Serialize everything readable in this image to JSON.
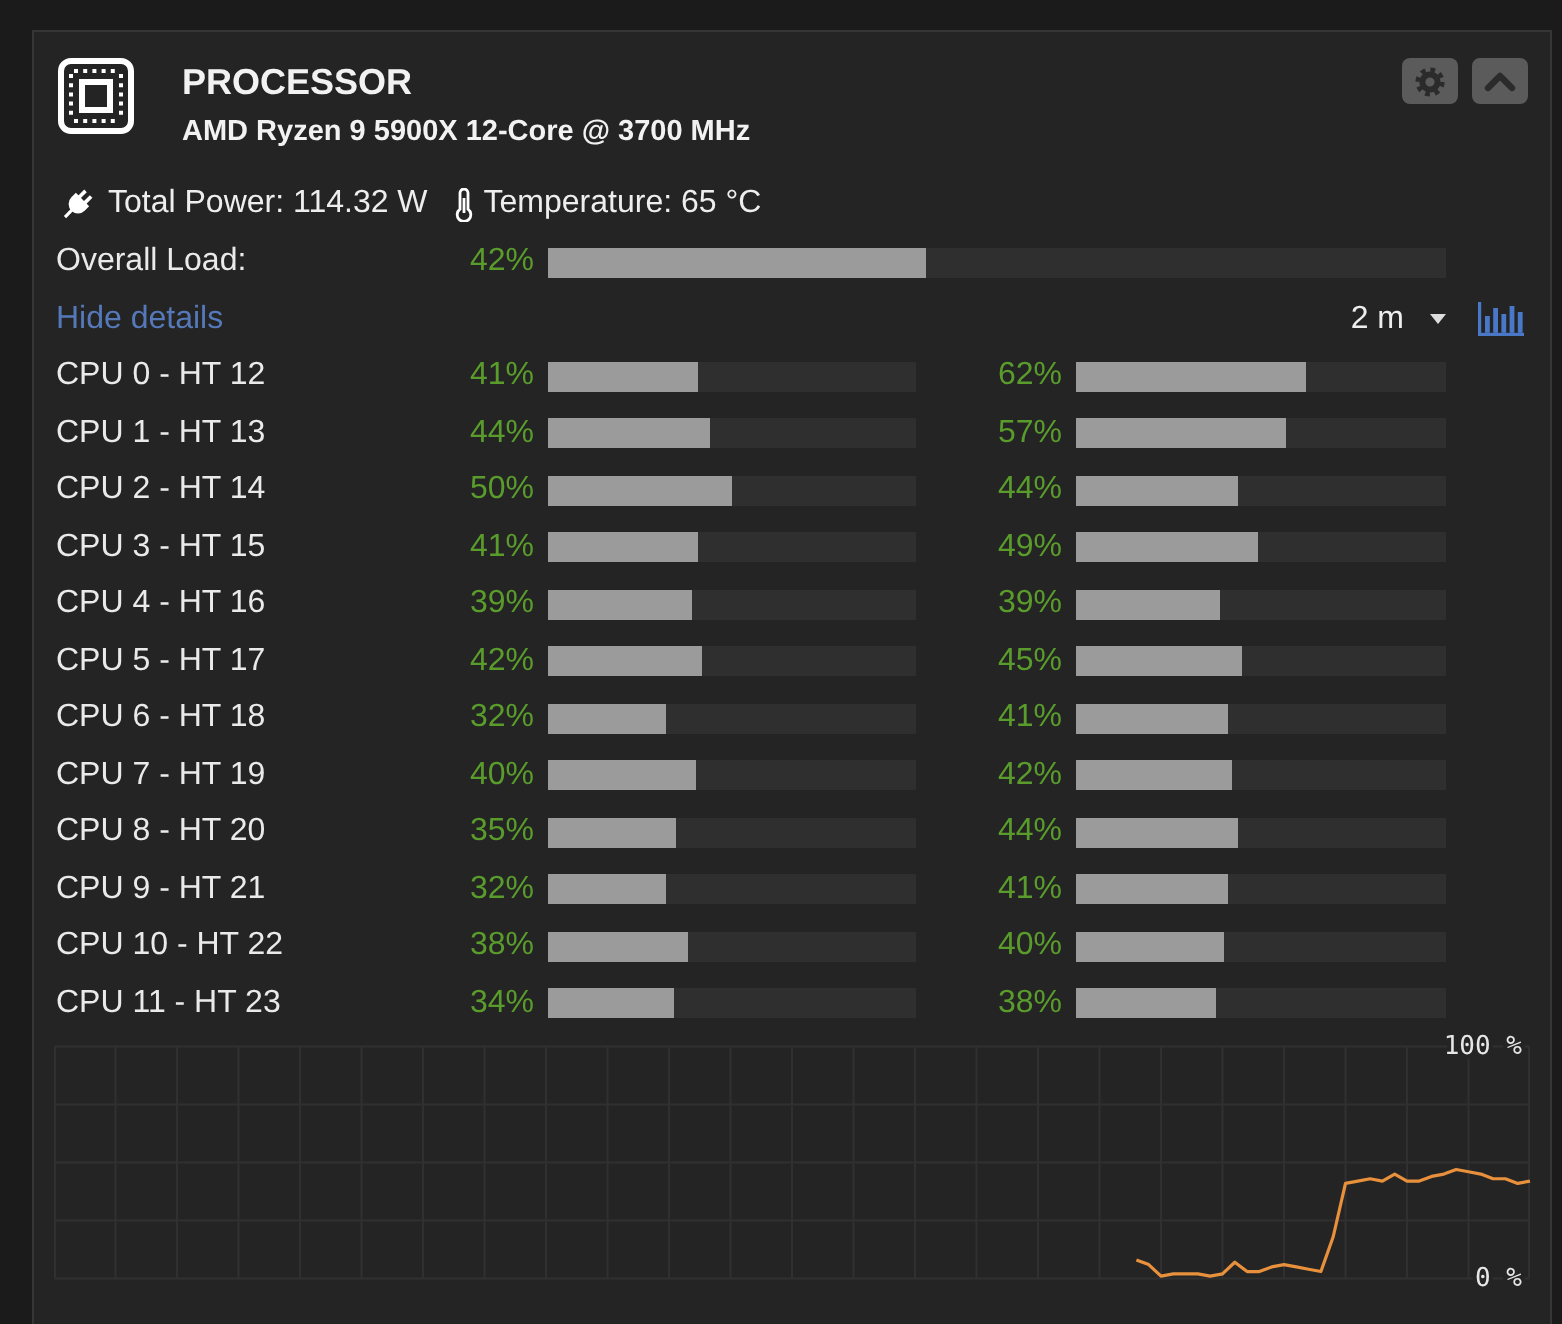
{
  "header": {
    "title": "PROCESSOR",
    "subtitle": "AMD Ryzen 9 5900X 12-Core @ 3700 MHz"
  },
  "stats": [
    {
      "kind": "power",
      "label": "Total Power: 114.32 W"
    },
    {
      "kind": "temperature",
      "label": "Temperature: 65 °C"
    }
  ],
  "overall_load": {
    "label": "Overall Load:",
    "reading": "42%",
    "level": 0.42
  },
  "details": {
    "link": "Hide details",
    "range": "2 m"
  },
  "cores": [
    {
      "label": "CPU 0 - HT 12",
      "threads": [
        {
          "reading": "41%",
          "level": 0.41
        },
        {
          "reading": "62%",
          "level": 0.62
        }
      ]
    },
    {
      "label": "CPU 1 - HT 13",
      "threads": [
        {
          "reading": "44%",
          "level": 0.44
        },
        {
          "reading": "57%",
          "level": 0.57
        }
      ]
    },
    {
      "label": "CPU 2 - HT 14",
      "threads": [
        {
          "reading": "50%",
          "level": 0.5
        },
        {
          "reading": "44%",
          "level": 0.44
        }
      ]
    },
    {
      "label": "CPU 3 - HT 15",
      "threads": [
        {
          "reading": "41%",
          "level": 0.41
        },
        {
          "reading": "49%",
          "level": 0.49
        }
      ]
    },
    {
      "label": "CPU 4 - HT 16",
      "threads": [
        {
          "reading": "39%",
          "level": 0.39
        },
        {
          "reading": "39%",
          "level": 0.39
        }
      ]
    },
    {
      "label": "CPU 5 - HT 17",
      "threads": [
        {
          "reading": "42%",
          "level": 0.42
        },
        {
          "reading": "45%",
          "level": 0.45
        }
      ]
    },
    {
      "label": "CPU 6 - HT 18",
      "threads": [
        {
          "reading": "32%",
          "level": 0.32
        },
        {
          "reading": "41%",
          "level": 0.41
        }
      ]
    },
    {
      "label": "CPU 7 - HT 19",
      "threads": [
        {
          "reading": "40%",
          "level": 0.4
        },
        {
          "reading": "42%",
          "level": 0.42
        }
      ]
    },
    {
      "label": "CPU 8 - HT 20",
      "threads": [
        {
          "reading": "35%",
          "level": 0.35
        },
        {
          "reading": "44%",
          "level": 0.44
        }
      ]
    },
    {
      "label": "CPU 9 - HT 21",
      "threads": [
        {
          "reading": "32%",
          "level": 0.32
        },
        {
          "reading": "41%",
          "level": 0.41
        }
      ]
    },
    {
      "label": "CPU 10 - HT 22",
      "threads": [
        {
          "reading": "38%",
          "level": 0.38
        },
        {
          "reading": "40%",
          "level": 0.4
        }
      ]
    },
    {
      "label": "CPU 11 - HT 23",
      "threads": [
        {
          "reading": "34%",
          "level": 0.34
        },
        {
          "reading": "38%",
          "level": 0.38
        }
      ]
    }
  ],
  "history": {
    "chart_data": {
      "type": "line",
      "ylim": [
        0,
        100
      ],
      "yticks": [
        {
          "value": 0,
          "label": "0 %"
        },
        {
          "value": 100,
          "label": "100 %"
        }
      ],
      "series": [
        {
          "color": "#e8903c",
          "values": [
            null,
            null,
            null,
            null,
            null,
            null,
            null,
            null,
            null,
            null,
            null,
            null,
            null,
            null,
            null,
            null,
            null,
            null,
            null,
            null,
            null,
            null,
            null,
            null,
            null,
            null,
            null,
            null,
            null,
            null,
            null,
            null,
            null,
            null,
            null,
            null,
            null,
            null,
            null,
            null,
            null,
            null,
            null,
            null,
            null,
            null,
            null,
            null,
            null,
            null,
            null,
            null,
            null,
            null,
            null,
            null,
            null,
            null,
            null,
            null,
            null,
            null,
            null,
            null,
            null,
            null,
            null,
            null,
            null,
            null,
            null,
            null,
            null,
            null,
            null,
            null,
            null,
            null,
            null,
            null,
            null,
            null,
            null,
            null,
            null,
            null,
            null,
            null,
            8,
            6,
            1,
            2,
            2,
            2,
            1,
            2,
            7,
            3,
            3,
            5,
            6,
            5,
            4,
            3,
            18,
            41,
            42,
            43,
            42,
            45,
            42,
            42,
            44,
            45,
            47,
            46,
            45,
            43,
            43,
            41,
            42
          ]
        }
      ]
    }
  }
}
